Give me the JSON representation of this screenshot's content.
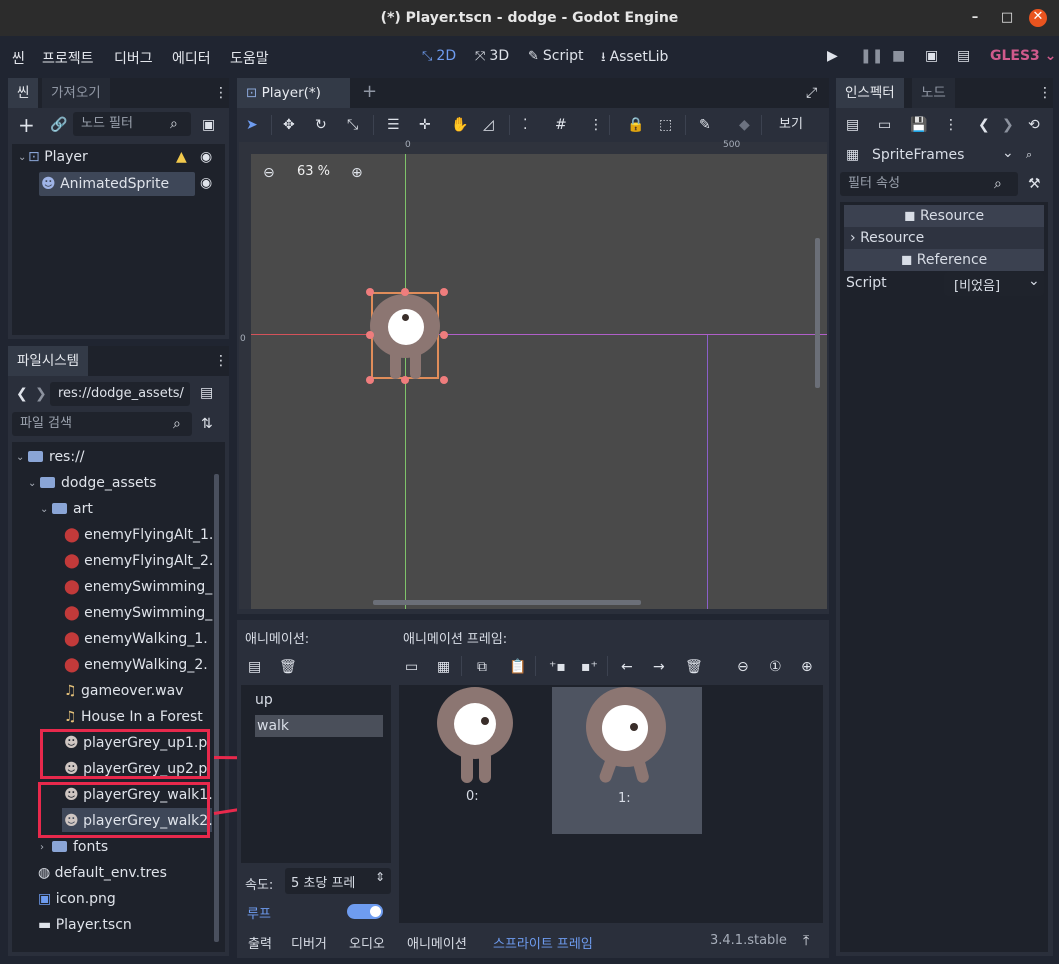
{
  "window": {
    "title": "(*) Player.tscn - dodge - Godot Engine",
    "min": "–",
    "max": "□",
    "close": "✕"
  },
  "menu": [
    "씬",
    "프로젝트",
    "디버그",
    "에디터",
    "도움말"
  ],
  "workspace": {
    "b2d": "2D",
    "b3d": "3D",
    "script": "Script",
    "assetlib": "AssetLib"
  },
  "renderer": "GLES3",
  "scene_dock": {
    "tab_scene": "씬",
    "tab_import": "가져오기",
    "filter_placeholder": "노드 필터",
    "nodes": [
      {
        "label": "Player"
      },
      {
        "label": "AnimatedSprite"
      }
    ]
  },
  "fs_dock": {
    "tab": "파일시스템",
    "path": "res://dodge_assets/",
    "search_placeholder": "파일 검색",
    "items": [
      {
        "label": "res://"
      },
      {
        "label": "dodge_assets"
      },
      {
        "label": "art"
      },
      {
        "label": "enemyFlyingAlt_1."
      },
      {
        "label": "enemyFlyingAlt_2."
      },
      {
        "label": "enemySwimming_"
      },
      {
        "label": "enemySwimming_"
      },
      {
        "label": "enemyWalking_1."
      },
      {
        "label": "enemyWalking_2."
      },
      {
        "label": "gameover.wav"
      },
      {
        "label": "House In a Forest"
      },
      {
        "label": "playerGrey_up1.p"
      },
      {
        "label": "playerGrey_up2.p"
      },
      {
        "label": "playerGrey_walk1."
      },
      {
        "label": "playerGrey_walk2."
      },
      {
        "label": "fonts"
      },
      {
        "label": "default_env.tres"
      },
      {
        "label": "icon.png"
      },
      {
        "label": "Player.tscn"
      }
    ]
  },
  "viewport": {
    "tab": "Player(*)",
    "zoom": "63 %",
    "view_btn": "보기",
    "ruler_0": "0",
    "ruler_500": "500",
    "ruler_left_0": "0"
  },
  "sprite_frames": {
    "anim_label": "애니메이션:",
    "frames_label": "애니메이션 프레임:",
    "animations": [
      "up",
      "walk"
    ],
    "frames": [
      "0:",
      "1:"
    ],
    "speed_label": "속도:",
    "speed_value": "5 초당 프레",
    "loop_label": "루프"
  },
  "bottom_tabs": [
    "출력",
    "디버거",
    "오디오",
    "애니메이션",
    "스프라이트 프레임"
  ],
  "version": "3.4.1.stable",
  "inspector": {
    "tab_inspector": "인스펙터",
    "tab_node": "노드",
    "resource_type": "SpriteFrames",
    "filter_placeholder": "필터 속성",
    "section_resource": "Resource",
    "sub_resource": "Resource",
    "section_reference": "Reference",
    "script_label": "Script",
    "script_value": "[비었음]"
  },
  "colors": {
    "accent": "#6e9cf0",
    "gles": "#d05a8c",
    "highlight": "#e8294c"
  }
}
